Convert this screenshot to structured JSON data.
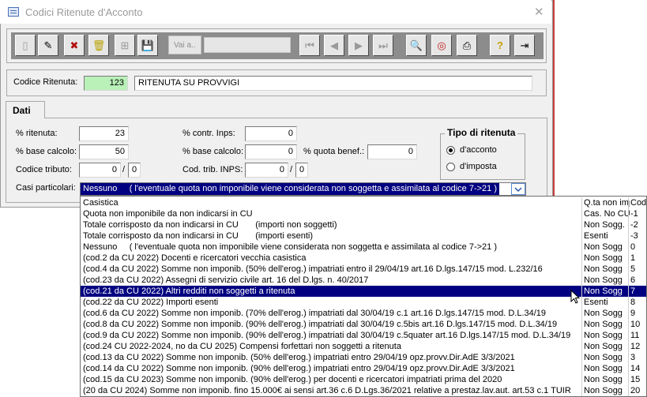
{
  "window": {
    "title": "Codici Ritenute d'Acconto",
    "close_glyph": "✕"
  },
  "toolbar": {
    "buttons": [
      {
        "name": "new-record-button",
        "icon": "new-doc-icon",
        "glyph": "▯"
      },
      {
        "name": "edit-record-button",
        "icon": "edit-icon",
        "glyph": "✎"
      },
      {
        "name": "cancel-button",
        "icon": "x-icon",
        "glyph": "✖"
      },
      {
        "name": "delete-button",
        "icon": "trash-icon",
        "glyph": "🗑"
      },
      {
        "name": "tree-button",
        "icon": "tree-icon",
        "glyph": "⊞"
      },
      {
        "name": "save-button",
        "icon": "floppy-icon",
        "glyph": "💾"
      },
      {
        "name": "first-record-button",
        "icon": "first-icon",
        "glyph": "⏮"
      },
      {
        "name": "prev-record-button",
        "icon": "prev-icon",
        "glyph": "◀"
      },
      {
        "name": "next-record-button",
        "icon": "next-icon",
        "glyph": "▶"
      },
      {
        "name": "last-record-button",
        "icon": "last-icon",
        "glyph": "⏭"
      },
      {
        "name": "search-button",
        "icon": "search-icon",
        "glyph": "🔍"
      },
      {
        "name": "refresh-button",
        "icon": "lifebuoy-icon",
        "glyph": "◎"
      },
      {
        "name": "print-button",
        "icon": "printer-icon",
        "glyph": "⎙"
      },
      {
        "name": "help-button",
        "icon": "help-icon",
        "glyph": "?"
      },
      {
        "name": "exit-button",
        "icon": "exit-icon",
        "glyph": "⇥"
      }
    ],
    "goto_label": "Vai a..",
    "goto_value": ""
  },
  "header": {
    "codice_label": "Codice Ritenuta:",
    "codice_value": "123",
    "descrizione_value": "RITENUTA SU PROVVIGI"
  },
  "tab": {
    "label": "Dati"
  },
  "form": {
    "ritenuta_label": "% ritenuta:",
    "ritenuta_value": "23",
    "base_label": "% base calcolo:",
    "base_value": "50",
    "tributo_label": "Codice tributo:",
    "tributo_value": "0",
    "tributo_sep": "/",
    "tributo_value2": "0",
    "inps_label": "% contr. Inps:",
    "inps_value": "0",
    "base_inps_label": "% base calcolo:",
    "base_inps_value": "0",
    "quota_label": "% quota benef.:",
    "quota_value": "0",
    "trib_inps_label": "Cod. trib. INPS:",
    "trib_inps_value": "0",
    "trib_inps_sep": "/",
    "trib_inps_value2": "0",
    "casi_label": "Casi particolari:",
    "casi_value": "Nessuno     ( l'eventuale quota non imponibile viene considerata non soggetta e assimilata al codice 7->21 )"
  },
  "tipo": {
    "title": "Tipo di ritenuta",
    "opt1": "d'acconto",
    "opt2": "d'imposta",
    "selected": "d'acconto"
  },
  "list": {
    "headers": [
      "Casistica",
      "Q.ta non imp",
      "Cod"
    ],
    "selected_index": 8,
    "rows": [
      [
        "Quota non imponibile da non indicarsi in CU",
        "Cas. No CU",
        "-1"
      ],
      [
        "Totale corrisposto da non indicarsi in CU       (importi non soggetti)",
        "Non Sogg.",
        "-2"
      ],
      [
        "Totale corrisposto da non indicarsi in CU       (importi esenti)",
        "Esenti",
        "-3"
      ],
      [
        "Nessuno     ( l'eventuale quota non imponibile viene considerata non soggetta e assimilata al codice 7->21 )",
        "Non Sogg",
        "0"
      ],
      [
        "(cod.2 da CU 2022) Docenti e ricercatori vecchia casistica",
        "Non Sogg",
        "1"
      ],
      [
        "(cod.4 da CU 2022) Somme non imponib. (50% dell'erog.) impatriati entro il 29/04/19 art.16 D.lgs.147/15 mod. L.232/16",
        "Non Sogg",
        "5"
      ],
      [
        "(cod.23 da CU 2022) Assegni di servizio civile art. 16 del D.lgs. n. 40/2017",
        "Non Sogg",
        "6"
      ],
      [
        "(cod.21 da CU 2022) Altri redditi non soggetti a ritenuta",
        "Non Sogg",
        "7"
      ],
      [
        "(cod.22 da CU 2022) Importi esenti",
        "Esenti",
        "8"
      ],
      [
        "(cod.6 da CU 2022) Somme non imponib. (70% dell'erog.) impatriati dal 30/04/19 c.1 art.16 D.lgs.147/15 mod. D.L.34/19",
        "Non Sogg",
        "9"
      ],
      [
        "(cod.8 da CU 2022) Somme non imponib. (90% dell'erog.) impatriati dal 30/04/19 c.5bis art.16 D.lgs.147/15 mod. D.L.34/19",
        "Non Sogg",
        "10"
      ],
      [
        "(cod.9 da CU 2022) Somme non imponib. (90% dell'erog.) impatriati dal 30/04/19 c.5quater art.16 D.lgs.147/15 mod. D.L.34/19",
        "Non Sogg",
        "11"
      ],
      [
        "(cod.24 CU 2022-2024, no da CU 2025) Compensi forfettari non soggetti a ritenuta",
        "Non Sogg",
        "12"
      ],
      [
        "(cod.13 da CU 2022) Somme non imponib. (50% dell'erog.) impatriati entro 29/04/19 opz.provv.Dir.AdE 3/3/2021",
        "Non Sogg",
        "3"
      ],
      [
        "(cod.14 da CU 2022) Somme non imponib. (90% dell'erog.) impatriati entro 29/04/19 opz.provv.Dir.AdE 3/3/2021",
        "Non Sogg",
        "14"
      ],
      [
        "(cod.15 da CU 2023) Somme non imponib. (90% dell'erog.) per docenti e ricercatori impatriati prima del 2020",
        "Non Sogg",
        "15"
      ],
      [
        "(20 da CU 2024) Somme non imponib. fino 15.000€ ai sensi art.36 c.6 D.Lgs.36/2021 relative a prestaz.lav.aut. art.53 c.1 TUIR",
        "Non Sogg",
        "20"
      ]
    ]
  },
  "colors": {
    "accent_green": "#b9f1b9",
    "selection": "#000080",
    "toolbar_gray": "#8c8c8c"
  }
}
